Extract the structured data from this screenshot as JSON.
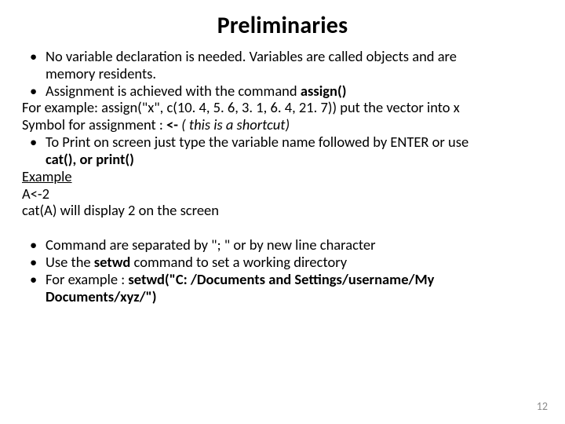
{
  "title": "Preliminaries",
  "block1": {
    "b1a": "No variable declaration is needed. Variables are called objects and are",
    "b1b": "memory residents.",
    "b2a": "Assignment is achieved with the command ",
    "b2a_bold": "assign()",
    "l1": "For example: assign(\"x\", c(10. 4, 5. 6, 3. 1, 6. 4, 21. 7)) put the vector into x",
    "l2a": "Symbol for assignment : ",
    "l2a_bold": "<-",
    "l2a_italic": " ( this is a shortcut)",
    "b3a": "To Print on screen just type the variable name followed by ENTER or use",
    "b3b_bold": "cat(), or print()",
    "ex": "Example",
    "ex1": "A<-2",
    "ex2": "cat(A) will display 2 on the screen"
  },
  "block2": {
    "b1": "Command are separated by \"; \" or by new line character",
    "b2a": "Use the ",
    "b2a_bold": "setwd",
    "b2b": " command to set a working directory",
    "b3a": "For example : ",
    "b3a_bold1": "setwd(",
    "b3a_rest": "\"C: /Documents and Settings/username/My",
    "b3b": "Documents/xyz/\")"
  },
  "pagenum": "12"
}
